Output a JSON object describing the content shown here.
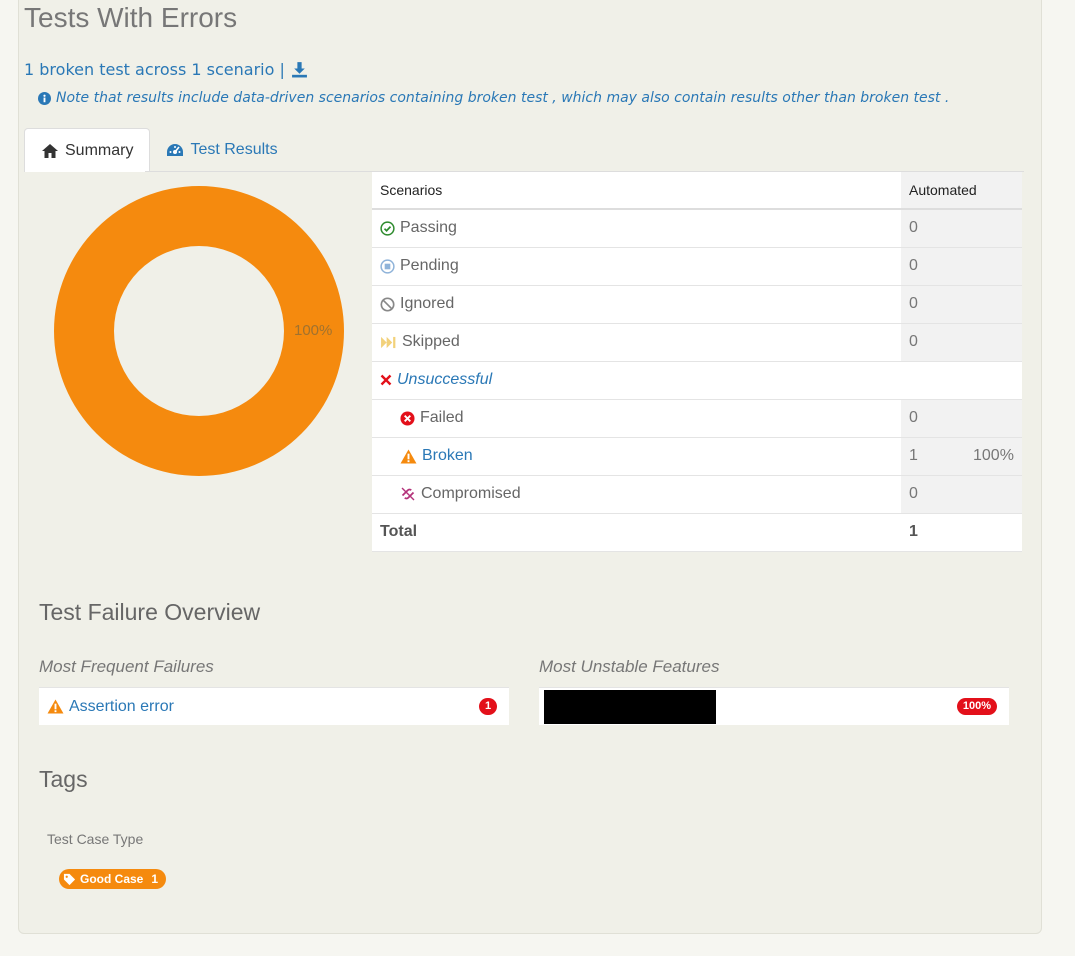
{
  "page": {
    "title": "Tests With Errors"
  },
  "summary": {
    "text": "1 broken test across 1 scenario |"
  },
  "note": {
    "text": "Note that results include data-driven scenarios containing broken test , which may also contain results other than broken test ."
  },
  "tabs": [
    {
      "label": "Summary",
      "icon": "home-icon"
    },
    {
      "label": "Test Results",
      "icon": "dashboard-icon"
    }
  ],
  "chart_data": {
    "type": "pie",
    "categories": [
      "Broken"
    ],
    "values": [
      100
    ],
    "labels": [
      "100%"
    ],
    "colors": [
      "#f58a0e"
    ]
  },
  "scenarios_table": {
    "header": {
      "label": "Scenarios",
      "automated": "Automated"
    },
    "rows": [
      {
        "label": "Passing",
        "count": "0",
        "pct": ""
      },
      {
        "label": "Pending",
        "count": "0",
        "pct": ""
      },
      {
        "label": "Ignored",
        "count": "0",
        "pct": ""
      },
      {
        "label": "Skipped",
        "count": "0",
        "pct": ""
      },
      {
        "label": "Unsuccessful",
        "count": "",
        "pct": ""
      },
      {
        "label": "Failed",
        "count": "0",
        "pct": ""
      },
      {
        "label": "Broken",
        "count": "1",
        "pct": "100%"
      },
      {
        "label": "Compromised",
        "count": "0",
        "pct": ""
      }
    ],
    "total": {
      "label": "Total",
      "count": "1"
    }
  },
  "overview": {
    "title": "Test Failure Overview",
    "frequent_failures": {
      "heading": "Most Frequent Failures",
      "items": [
        {
          "label": "Assertion error",
          "count": "1"
        }
      ]
    },
    "unstable_features": {
      "heading": "Most Unstable Features",
      "items": [
        {
          "label": "",
          "pct": "100%"
        }
      ]
    }
  },
  "tags": {
    "title": "Tags",
    "type_label": "Test Case Type",
    "items": [
      {
        "label": "Good Case",
        "count": "1"
      }
    ]
  },
  "colors": {
    "accent_blue": "#2a78b6",
    "broken_orange": "#f58a0e",
    "error_red": "#e3101a"
  }
}
